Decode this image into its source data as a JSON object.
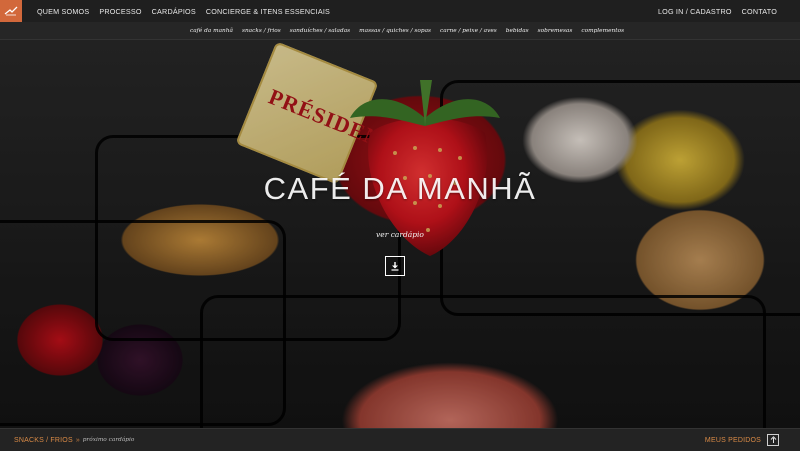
{
  "header": {
    "nav_left": [
      {
        "label": "QUEM SOMOS"
      },
      {
        "label": "PROCESSO"
      },
      {
        "label": "CARDÁPIOS"
      },
      {
        "label": "CONCIERGE & ITENS ESSENCIAIS"
      }
    ],
    "nav_right": [
      {
        "label": "LOG IN / CADASTRO"
      },
      {
        "label": "CONTATO"
      }
    ]
  },
  "subnav": {
    "items": [
      {
        "label": "café da manhã"
      },
      {
        "label": "snacks / frios"
      },
      {
        "label": "sanduíches / saladas"
      },
      {
        "label": "massas / quiches / sopas"
      },
      {
        "label": "carne / peixe / aves"
      },
      {
        "label": "bebidas"
      },
      {
        "label": "sobremesas"
      },
      {
        "label": "complementos"
      }
    ]
  },
  "hero": {
    "title": "CAFÉ DA MANHÃ",
    "subtitle": "ver cardápio",
    "butter_brand": "PRÉSIDENT"
  },
  "footer": {
    "category": "SNACKS / FRIOS",
    "separator": "»",
    "next_label": "próximo cardápio",
    "orders_label": "MEUS PEDIDOS"
  },
  "colors": {
    "accent": "#d2683b",
    "footer_text": "#d98a46",
    "bar_bg": "#1f1f1f"
  },
  "icons": [
    "logo-icon",
    "arrow-down-icon",
    "arrow-up-icon"
  ]
}
